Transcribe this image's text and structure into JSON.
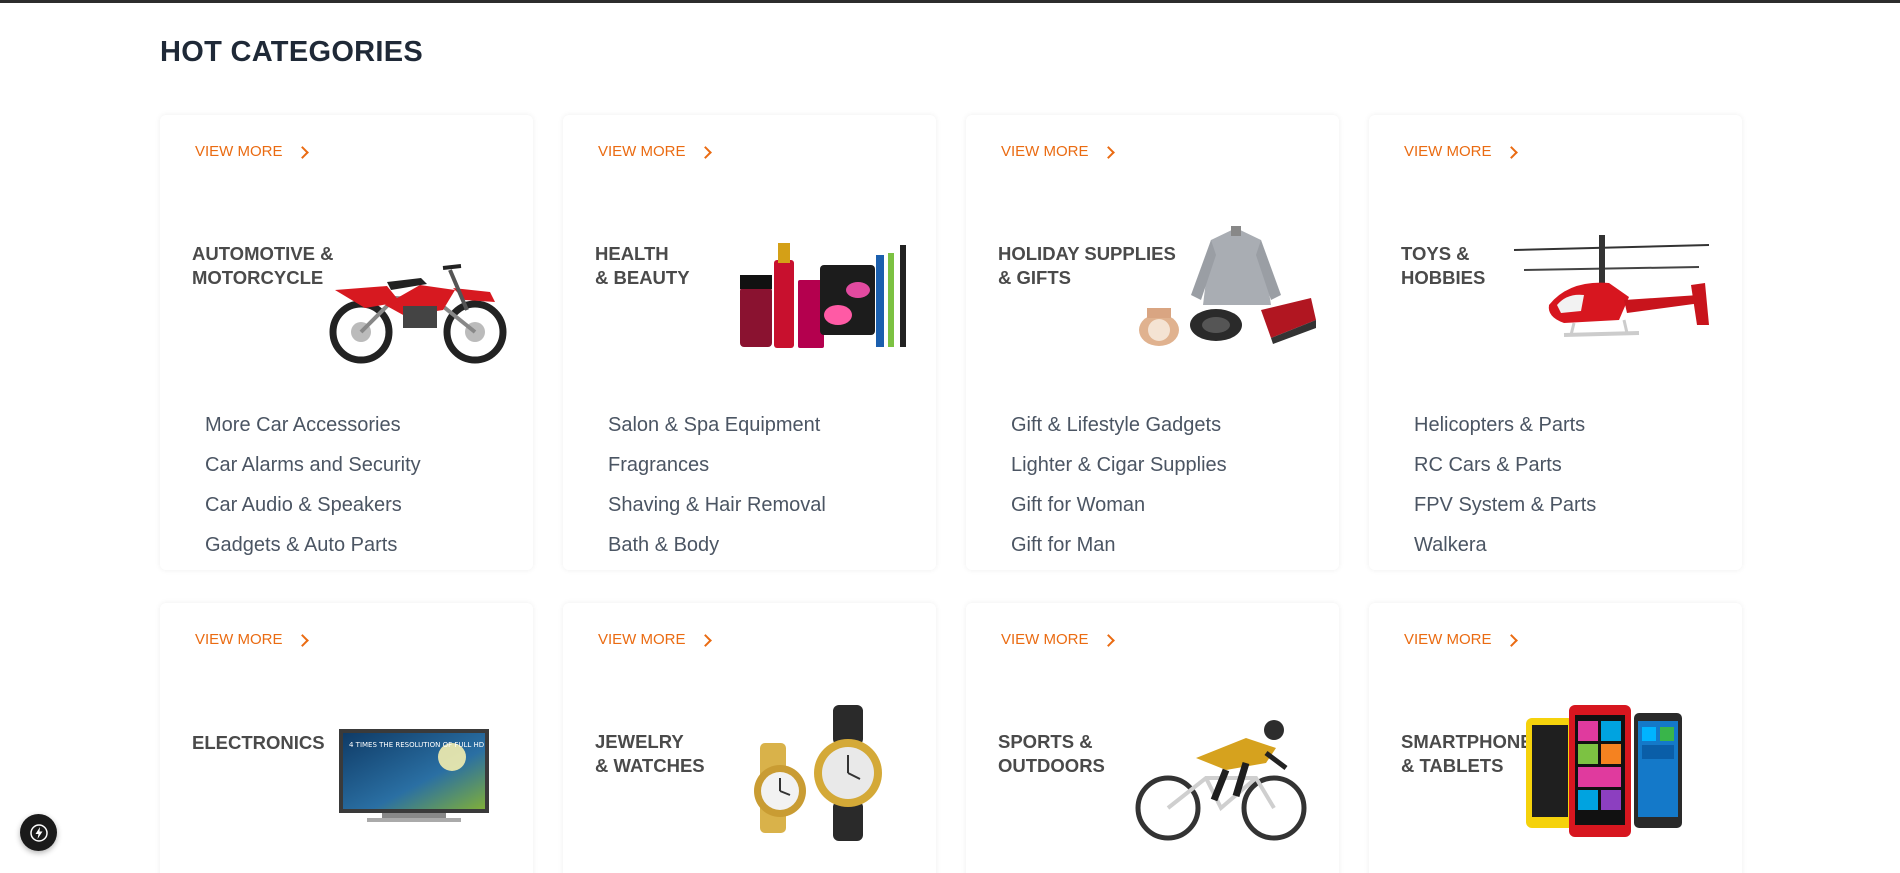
{
  "page": {
    "title": "HOT CATEGORIES"
  },
  "cards": [
    {
      "view_more": "VIEW MORE",
      "title": "AUTOMOTIVE &\nMOTORCYCLE",
      "image": "motorcycle-image",
      "links": [
        "More Car Accessories",
        "Car Alarms and Security",
        "Car Audio & Speakers",
        "Gadgets & Auto Parts"
      ]
    },
    {
      "view_more": "VIEW MORE",
      "title": "HEALTH\n& BEAUTY",
      "image": "cosmetics-image",
      "links": [
        "Salon & Spa Equipment",
        "Fragrances",
        "Shaving & Hair Removal",
        "Bath & Body"
      ]
    },
    {
      "view_more": "VIEW MORE",
      "title": "HOLIDAY SUPPLIES\n& GIFTS",
      "image": "gifts-image",
      "links": [
        "Gift & Lifestyle Gadgets",
        "Lighter & Cigar Supplies",
        "Gift for Woman",
        "Gift for Man"
      ]
    },
    {
      "view_more": "VIEW MORE",
      "title": "TOYS &\nHOBBIES",
      "image": "helicopter-image",
      "links": [
        "Helicopters & Parts",
        "RC Cars & Parts",
        "FPV System & Parts",
        "Walkera"
      ]
    },
    {
      "view_more": "VIEW MORE",
      "title": "ELECTRONICS",
      "image": "tv-image",
      "tv_text": "4 TIMES THE RESOLUTION OF FULL HD",
      "links": []
    },
    {
      "view_more": "VIEW MORE",
      "title": "JEWELRY\n& WATCHES",
      "image": "watches-image",
      "links": []
    },
    {
      "view_more": "VIEW MORE",
      "title": "SPORTS &\nOUTDOORS",
      "image": "cyclist-image",
      "links": []
    },
    {
      "view_more": "VIEW MORE",
      "title": "SMARTPHONES\n& TABLETS",
      "image": "smartphones-image",
      "links": []
    }
  ],
  "fab": {
    "icon": "lightning-icon"
  },
  "colors": {
    "accent": "#ea6b12",
    "title": "#1f2937",
    "link": "#4b5563"
  }
}
